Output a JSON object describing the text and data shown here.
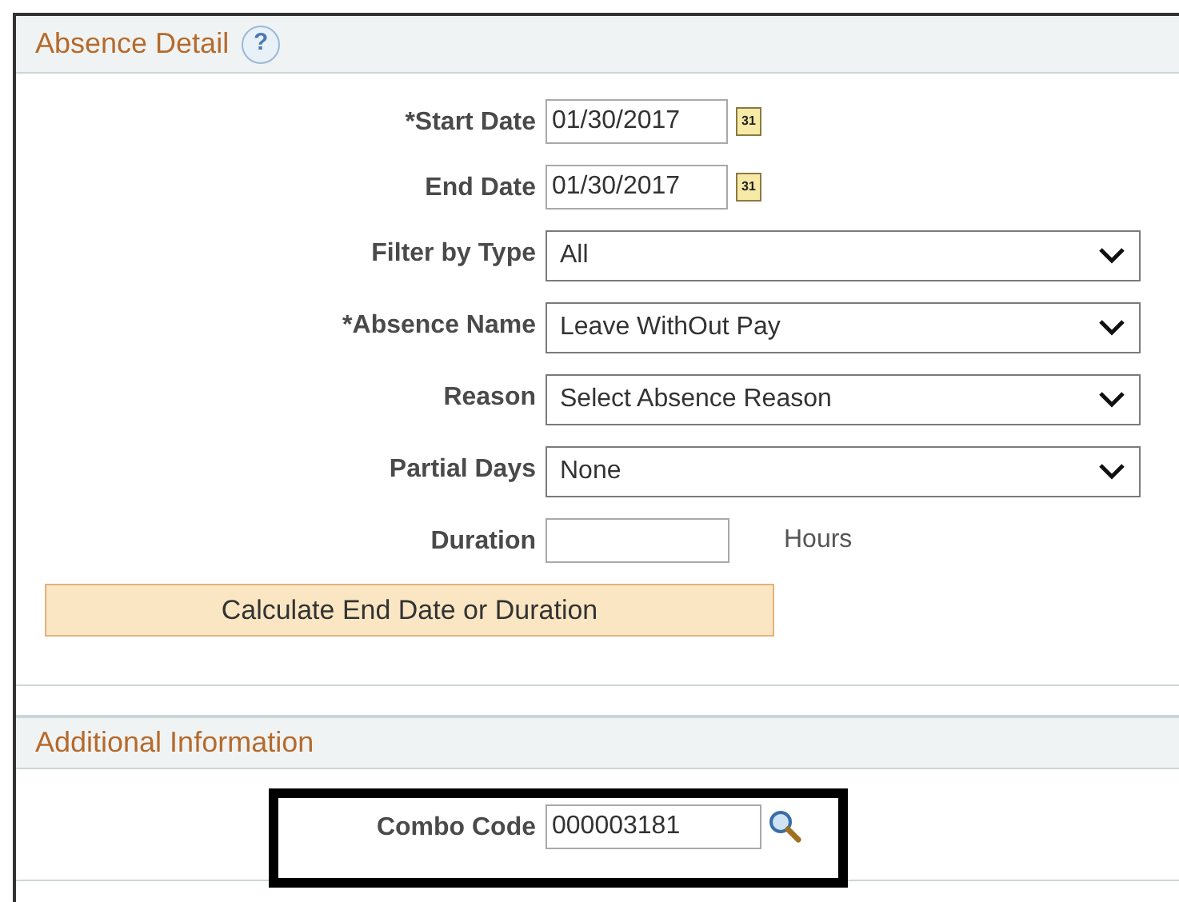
{
  "absence_detail": {
    "title": "Absence Detail",
    "help": "?",
    "fields": [
      {
        "kind": "date",
        "label": "*Start Date",
        "value": "01/30/2017",
        "icon_text": "31"
      },
      {
        "kind": "date",
        "label": "End Date",
        "value": "01/30/2017",
        "icon_text": "31"
      },
      {
        "kind": "select",
        "label": "Filter by Type",
        "value": "All"
      },
      {
        "kind": "select",
        "label": "*Absence Name",
        "value": "Leave WithOut Pay"
      },
      {
        "kind": "select",
        "label": "Reason",
        "value": "Select Absence Reason"
      },
      {
        "kind": "select",
        "label": "Partial Days",
        "value": "None"
      },
      {
        "kind": "text",
        "label": "Duration",
        "unit": "Hours"
      }
    ],
    "button": "Calculate End Date or Duration"
  },
  "additional_information": {
    "title": "Additional Information",
    "fields": [
      {
        "kind": "lookup",
        "label": "Combo Code",
        "value": "000003181",
        "highlighted": true
      }
    ]
  }
}
